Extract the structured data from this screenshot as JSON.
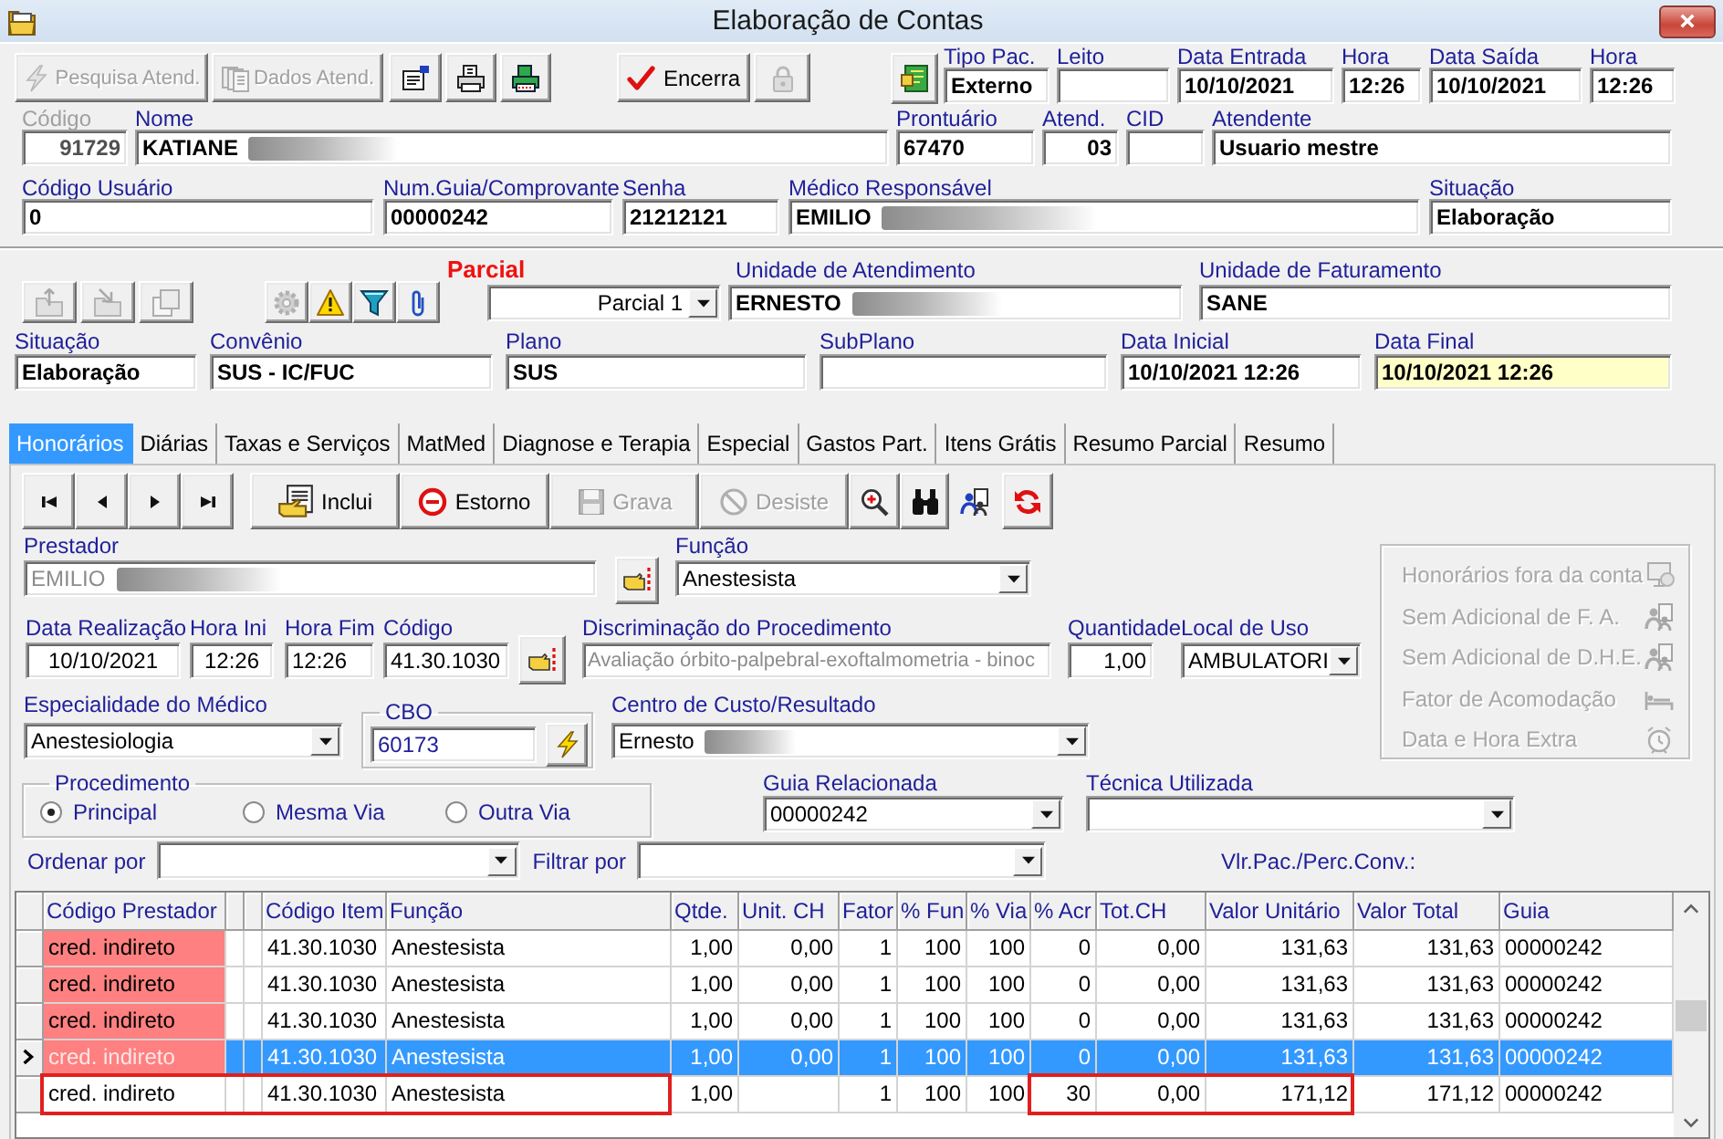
{
  "window": {
    "title": "Elaboração de Contas"
  },
  "toolbar": [
    {
      "label": "Pesquisa Atend.",
      "disabled": true
    },
    {
      "label": "Dados Atend.",
      "disabled": true
    },
    {
      "disabled": false
    },
    {
      "disabled": false
    },
    {
      "disabled": false
    },
    {
      "label": "Encerra",
      "disabled": false
    },
    {
      "disabled": true
    },
    {
      "disabled": false
    }
  ],
  "header": {
    "row_1": [
      {
        "label": "Tipo Pac.",
        "value": "Externo"
      },
      {
        "label": "Leito"
      },
      {
        "label": "Data Entrada",
        "value": "10/10/2021"
      },
      {
        "label": "Hora",
        "value": "12:26"
      },
      {
        "label": "Data Saída",
        "value": "10/10/2021"
      },
      {
        "label": "Hora",
        "value": "12:26"
      }
    ],
    "row_2": [
      {
        "label": "Código",
        "value": "91729",
        "disabled": true,
        "redacted": false
      },
      {
        "label": "Nome",
        "value": "KATIANE",
        "disabled": false,
        "redacted": true
      },
      {
        "label": "Prontuário",
        "value": "67470",
        "disabled": false,
        "redacted": false
      },
      {
        "label": "Atend.",
        "value": "03",
        "disabled": false,
        "redacted": false
      },
      {
        "label": "CID",
        "disabled": false,
        "redacted": false
      },
      {
        "label": "Atendente",
        "value": "Usuario mestre",
        "disabled": false,
        "redacted": false
      }
    ],
    "row_3": [
      {
        "label": "Código Usuário",
        "value": "0",
        "redacted": false
      },
      {
        "label": "Num.Guia/Comprovante",
        "value": "00000242",
        "redacted": false
      },
      {
        "label": "Senha",
        "value": "21212121",
        "redacted": false
      },
      {
        "label": "Médico Responsável",
        "value": "EMILIO",
        "redacted": true
      },
      {
        "label": "Situação",
        "value": "Elaboração",
        "redacted": false
      }
    ]
  },
  "account": {
    "tools": [
      {
        "disabled": true
      },
      {
        "disabled": true
      },
      {
        "disabled": true
      },
      {
        "disabled": true
      },
      {
        "disabled": false
      },
      {
        "disabled": false
      },
      {
        "disabled": false
      }
    ],
    "parcial": {
      "label": "Parcial",
      "value": "Parcial 1"
    },
    "units": [
      {
        "label": "Unidade de Atendimento",
        "value": "ERNESTO",
        "redacted": true
      },
      {
        "label": "Unidade de Faturamento",
        "value": "SANE",
        "redacted": false
      }
    ],
    "fields": [
      {
        "label": "Situação",
        "value": "Elaboração",
        "focused": false
      },
      {
        "label": "Convênio",
        "value": "SUS - IC/FUC",
        "focused": false
      },
      {
        "label": "Plano",
        "value": "SUS",
        "focused": false
      },
      {
        "label": "SubPlano",
        "focused": false
      },
      {
        "label": "Data Inicial",
        "value": "10/10/2021 12:26",
        "focused": false
      },
      {
        "label": "Data Final",
        "value": "10/10/2021 12:26",
        "focused": true
      }
    ]
  },
  "tabs": [
    {
      "label": "Honorários",
      "selected": true
    },
    {
      "label": "Diárias",
      "selected": false
    },
    {
      "label": "Taxas e Serviços",
      "selected": false
    },
    {
      "label": "MatMed",
      "selected": false
    },
    {
      "label": "Diagnose e Terapia",
      "selected": false
    },
    {
      "label": "Especial",
      "selected": false
    },
    {
      "label": "Gastos Part.",
      "selected": false
    },
    {
      "label": "Itens Grátis",
      "selected": false
    },
    {
      "label": "Resumo Parcial",
      "selected": false
    },
    {
      "label": "Resumo",
      "selected": false
    }
  ],
  "honorarios": {
    "nav": [
      {
        "disabled": false
      },
      {
        "disabled": false
      },
      {
        "disabled": false
      },
      {
        "disabled": false
      },
      {
        "label": "Inclui",
        "disabled": false
      },
      {
        "label": "Estorno",
        "disabled": false
      },
      {
        "label": "Grava",
        "disabled": true
      },
      {
        "label": "Desiste",
        "disabled": true
      },
      {
        "disabled": false
      },
      {
        "disabled": false
      },
      {
        "disabled": false
      },
      {
        "disabled": false
      }
    ],
    "prestador": {
      "label": "Prestador",
      "value": "EMILIO",
      "redacted": true,
      "read_only": true
    },
    "funcao": {
      "label": "Função",
      "value": "Anestesista"
    },
    "options": [
      {
        "label": "Honorários fora da conta",
        "disabled": true
      },
      {
        "label": "Sem Adicional de F. A.",
        "disabled": true
      },
      {
        "label": "Sem Adicional de D.H.E.",
        "disabled": true
      },
      {
        "label": "Fator de Acomodação",
        "disabled": true
      },
      {
        "label": "Data e Hora Extra",
        "disabled": true
      }
    ],
    "procedure": [
      {
        "label": "Data Realização",
        "value": "10/10/2021",
        "read_only": false
      },
      {
        "label": "Hora Ini",
        "value": "12:26",
        "read_only": false
      },
      {
        "label": "Hora Fim",
        "value": "12:26",
        "read_only": false
      },
      {
        "label": "Código",
        "value": "41.30.1030",
        "read_only": false
      },
      {
        "label": "Discriminação do Procedimento",
        "value": "Avaliação órbito-palpebral-exoftalmometria - binoc",
        "read_only": true
      },
      {
        "label": "Quantidade",
        "value": "1,00",
        "read_only": false
      },
      {
        "label": "Local de Uso",
        "value": "AMBULATORI",
        "read_only": false
      }
    ],
    "especialidade": {
      "label": "Especialidade do Médico",
      "value": "Anestesiologia"
    },
    "cbo": {
      "label": "CBO",
      "value": "60173"
    },
    "centro_custo": {
      "label": "Centro de Custo/Resultado",
      "value": "Ernesto",
      "redacted": true
    },
    "procedimento": {
      "label": "Procedimento",
      "options": [
        {
          "label": "Principal",
          "selected": true
        },
        {
          "label": "Mesma Via",
          "selected": false
        },
        {
          "label": "Outra Via",
          "selected": false
        }
      ]
    },
    "guia_relacionada": {
      "label": "Guia Relacionada",
      "value": "00000242"
    },
    "tecnica": {
      "label": "Técnica Utilizada"
    },
    "ordenar_por": {
      "label": "Ordenar por"
    },
    "filtrar_por": {
      "label": "Filtrar por"
    },
    "vlr_pac_label": "Vlr.Pac./Perc.Conv.:",
    "table": {
      "columns": [
        {
          "label": "Código Prestador"
        },
        {},
        {},
        {
          "label": "Código Item"
        },
        {
          "label": "Função"
        },
        {
          "label": "Qtde."
        },
        {
          "label": "Unit. CH"
        },
        {
          "label": "Fator"
        },
        {
          "label": "% Fun"
        },
        {
          "label": "% Via"
        },
        {
          "label": "% Acr"
        },
        {
          "label": "Tot.CH"
        },
        {
          "label": "Valor Unitário"
        },
        {
          "label": "Valor Total"
        },
        {
          "label": "Guia"
        }
      ],
      "rows": [
        {
          "selected": false,
          "highlighted": true,
          "cells": [
            {
              "text": "cred. indireto",
              "outlined": false
            },
            {
              "outlined": false
            },
            {
              "outlined": false
            },
            {
              "text": "41.30.1030",
              "outlined": false
            },
            {
              "text": "Anestesista",
              "outlined": false
            },
            {
              "text": "1,00",
              "outlined": false
            },
            {
              "text": "0,00",
              "outlined": false
            },
            {
              "text": "1",
              "outlined": false
            },
            {
              "text": "100",
              "outlined": false
            },
            {
              "text": "100",
              "outlined": false
            },
            {
              "text": "0",
              "outlined": false
            },
            {
              "text": "0,00",
              "outlined": false
            },
            {
              "text": "131,63",
              "outlined": false
            },
            {
              "text": "131,63",
              "outlined": false
            },
            {
              "text": "00000242",
              "outlined": false
            }
          ]
        },
        {
          "selected": false,
          "highlighted": true,
          "cells": [
            {
              "text": "cred. indireto",
              "outlined": false
            },
            {
              "outlined": false
            },
            {
              "outlined": false
            },
            {
              "text": "41.30.1030",
              "outlined": false
            },
            {
              "text": "Anestesista",
              "outlined": false
            },
            {
              "text": "1,00",
              "outlined": false
            },
            {
              "text": "0,00",
              "outlined": false
            },
            {
              "text": "1",
              "outlined": false
            },
            {
              "text": "100",
              "outlined": false
            },
            {
              "text": "100",
              "outlined": false
            },
            {
              "text": "0",
              "outlined": false
            },
            {
              "text": "0,00",
              "outlined": false
            },
            {
              "text": "131,63",
              "outlined": false
            },
            {
              "text": "131,63",
              "outlined": false
            },
            {
              "text": "00000242",
              "outlined": false
            }
          ]
        },
        {
          "selected": false,
          "highlighted": true,
          "cells": [
            {
              "text": "cred. indireto",
              "outlined": false
            },
            {
              "outlined": false
            },
            {
              "outlined": false
            },
            {
              "text": "41.30.1030",
              "outlined": false
            },
            {
              "text": "Anestesista",
              "outlined": false
            },
            {
              "text": "1,00",
              "outlined": false
            },
            {
              "text": "0,00",
              "outlined": false
            },
            {
              "text": "1",
              "outlined": false
            },
            {
              "text": "100",
              "outlined": false
            },
            {
              "text": "100",
              "outlined": false
            },
            {
              "text": "0",
              "outlined": false
            },
            {
              "text": "0,00",
              "outlined": false
            },
            {
              "text": "131,63",
              "outlined": false
            },
            {
              "text": "131,63",
              "outlined": false
            },
            {
              "text": "00000242",
              "outlined": false
            }
          ]
        },
        {
          "selected": true,
          "highlighted": true,
          "cells": [
            {
              "text": "cred. indireto",
              "outlined": false
            },
            {
              "outlined": false
            },
            {
              "outlined": false
            },
            {
              "text": "41.30.1030",
              "outlined": false
            },
            {
              "text": "Anestesista",
              "outlined": false
            },
            {
              "text": "1,00",
              "outlined": false
            },
            {
              "text": "0,00",
              "outlined": false
            },
            {
              "text": "1",
              "outlined": false
            },
            {
              "text": "100",
              "outlined": false
            },
            {
              "text": "100",
              "outlined": false
            },
            {
              "text": "0",
              "outlined": false
            },
            {
              "text": "0,00",
              "outlined": false
            },
            {
              "text": "131,63",
              "outlined": false
            },
            {
              "text": "131,63",
              "outlined": false
            },
            {
              "text": "00000242",
              "outlined": false
            }
          ]
        },
        {
          "selected": false,
          "highlighted": false,
          "cells": [
            {
              "text": "cred. indireto",
              "outlined": true
            },
            {
              "outlined": true
            },
            {
              "outlined": true
            },
            {
              "text": "41.30.1030",
              "outlined": true
            },
            {
              "text": "Anestesista",
              "outlined": true
            },
            {
              "text": "1,00",
              "outlined": false
            },
            {
              "outlined": false
            },
            {
              "text": "1",
              "outlined": false
            },
            {
              "text": "100",
              "outlined": false
            },
            {
              "text": "100",
              "outlined": false
            },
            {
              "text": "30",
              "outlined": true
            },
            {
              "text": "0,00",
              "outlined": true
            },
            {
              "text": "171,12",
              "outlined": true
            },
            {
              "text": "171,12",
              "outlined": false
            },
            {
              "text": "00000242",
              "outlined": false
            }
          ]
        }
      ]
    }
  }
}
